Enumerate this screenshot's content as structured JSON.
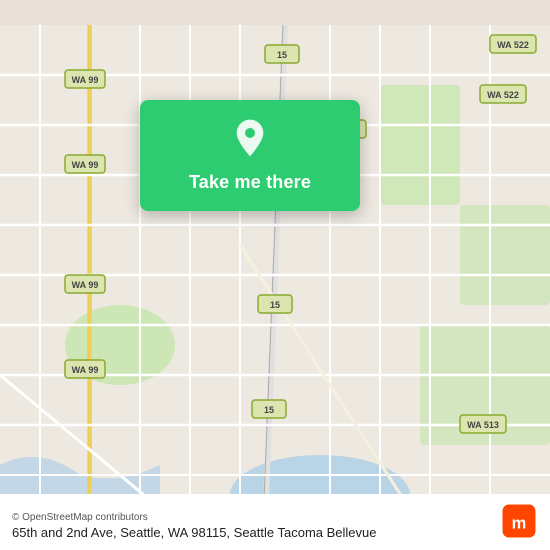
{
  "map": {
    "background_color": "#e8e0d8",
    "center_lat": 47.675,
    "center_lng": -122.335
  },
  "card": {
    "button_label": "Take me there",
    "background_color": "#2ecc71"
  },
  "bottom_bar": {
    "osm_credit": "© OpenStreetMap contributors",
    "address": "65th and 2nd Ave, Seattle, WA 98115, Seattle Tacoma Bellevue"
  },
  "icons": {
    "pin": "location-pin-icon",
    "moovit": "moovit-logo-icon"
  }
}
